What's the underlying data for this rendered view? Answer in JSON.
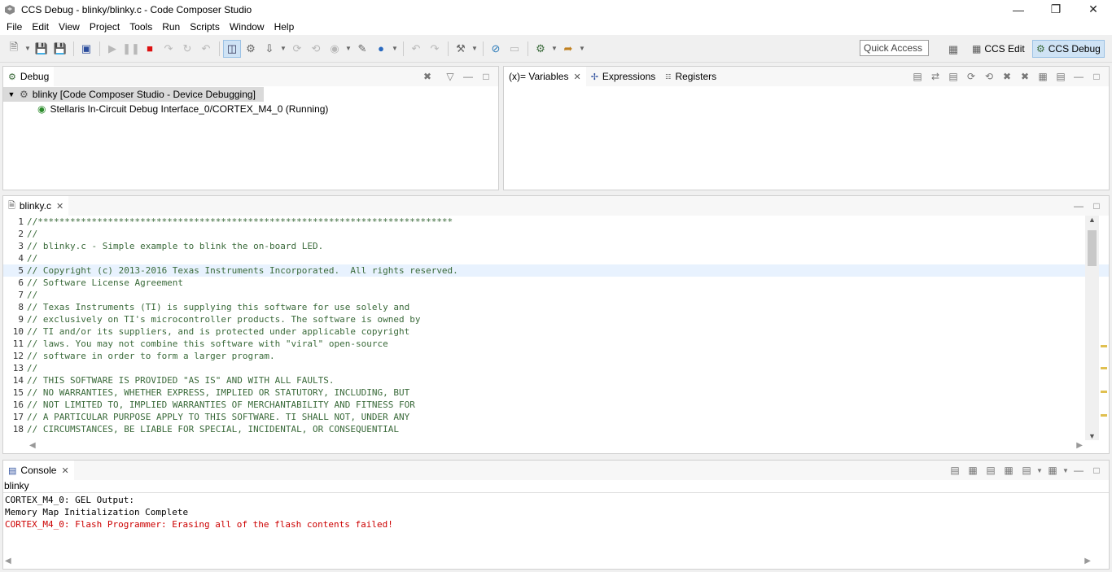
{
  "window": {
    "title": "CCS Debug - blinky/blinky.c - Code Composer Studio"
  },
  "menu": [
    "File",
    "Edit",
    "View",
    "Project",
    "Tools",
    "Run",
    "Scripts",
    "Window",
    "Help"
  ],
  "quick_access": "Quick Access",
  "perspectives": [
    {
      "label": "CCS Edit"
    },
    {
      "label": "CCS Debug"
    }
  ],
  "debug_view": {
    "tab": "Debug",
    "root": "blinky [Code Composer Studio - Device Debugging]",
    "child": "Stellaris In-Circuit Debug Interface_0/CORTEX_M4_0 (Running)"
  },
  "variables_view": {
    "tabs": [
      {
        "label": "(x)= Variables"
      },
      {
        "label": "Expressions"
      },
      {
        "label": "Registers"
      }
    ]
  },
  "editor": {
    "tab": "blinky.c",
    "lines": [
      {
        "n": "1",
        "t": "//*****************************************************************************"
      },
      {
        "n": "2",
        "t": "//"
      },
      {
        "n": "3",
        "t": "// blinky.c - Simple example to blink the on-board LED."
      },
      {
        "n": "4",
        "t": "//"
      },
      {
        "n": "5",
        "t": "// Copyright (c) 2013-2016 Texas Instruments Incorporated.  All rights reserved."
      },
      {
        "n": "6",
        "t": "// Software License Agreement"
      },
      {
        "n": "7",
        "t": "//"
      },
      {
        "n": "8",
        "t": "// Texas Instruments (TI) is supplying this software for use solely and"
      },
      {
        "n": "9",
        "t": "// exclusively on TI's microcontroller products. The software is owned by"
      },
      {
        "n": "10",
        "t": "// TI and/or its suppliers, and is protected under applicable copyright"
      },
      {
        "n": "11",
        "t": "// laws. You may not combine this software with \"viral\" open-source"
      },
      {
        "n": "12",
        "t": "// software in order to form a larger program."
      },
      {
        "n": "13",
        "t": "//"
      },
      {
        "n": "14",
        "t": "// THIS SOFTWARE IS PROVIDED \"AS IS\" AND WITH ALL FAULTS."
      },
      {
        "n": "15",
        "t": "// NO WARRANTIES, WHETHER EXPRESS, IMPLIED OR STATUTORY, INCLUDING, BUT"
      },
      {
        "n": "16",
        "t": "// NOT LIMITED TO, IMPLIED WARRANTIES OF MERCHANTABILITY AND FITNESS FOR"
      },
      {
        "n": "17",
        "t": "// A PARTICULAR PURPOSE APPLY TO THIS SOFTWARE. TI SHALL NOT, UNDER ANY"
      },
      {
        "n": "18",
        "t": "// CIRCUMSTANCES, BE LIABLE FOR SPECIAL, INCIDENTAL, OR CONSEQUENTIAL"
      }
    ]
  },
  "console": {
    "tab": "Console",
    "filter": "blinky",
    "lines": [
      {
        "t": "CORTEX_M4_0: GEL Output:",
        "err": false
      },
      {
        "t": "Memory Map Initialization Complete",
        "err": false
      },
      {
        "t": "CORTEX_M4_0: Flash Programmer: Erasing all of the flash contents failed!",
        "err": true
      }
    ]
  },
  "colors": {
    "error": "#cc0000",
    "comment": "#3a6a3a",
    "selection": "#dadada"
  }
}
